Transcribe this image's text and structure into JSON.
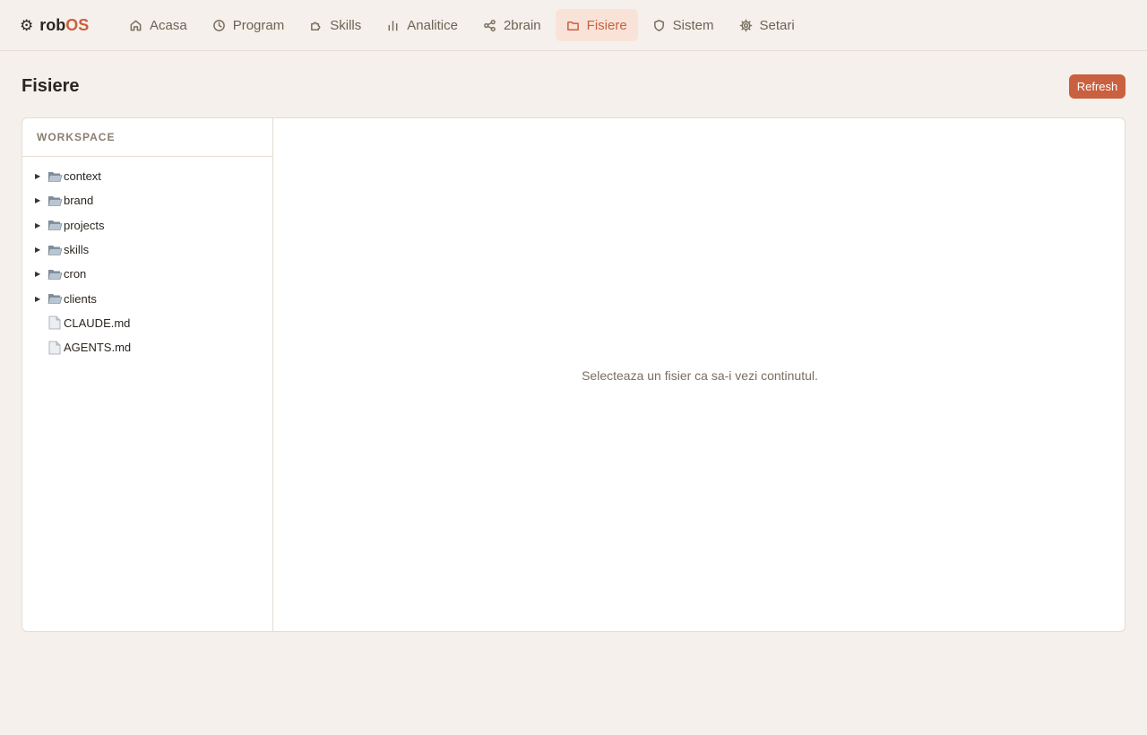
{
  "brand": {
    "prefix": "rob",
    "accent": "OS",
    "icon": "gear-icon"
  },
  "nav": [
    {
      "label": "Acasa",
      "icon": "home-icon",
      "active": false
    },
    {
      "label": "Program",
      "icon": "clock-icon",
      "active": false
    },
    {
      "label": "Skills",
      "icon": "puzzle-icon",
      "active": false
    },
    {
      "label": "Analitice",
      "icon": "bar-chart-icon",
      "active": false
    },
    {
      "label": "2brain",
      "icon": "share-icon",
      "active": false
    },
    {
      "label": "Fisiere",
      "icon": "folder-icon",
      "active": true
    },
    {
      "label": "Sistem",
      "icon": "shield-icon",
      "active": false
    },
    {
      "label": "Setari",
      "icon": "settings-icon",
      "active": false
    }
  ],
  "page": {
    "title": "Fisiere",
    "refresh_label": "Refresh"
  },
  "sidebar": {
    "header": "WORKSPACE",
    "items": [
      {
        "name": "context",
        "type": "folder"
      },
      {
        "name": "brand",
        "type": "folder"
      },
      {
        "name": "projects",
        "type": "folder"
      },
      {
        "name": "skills",
        "type": "folder"
      },
      {
        "name": "cron",
        "type": "folder"
      },
      {
        "name": "clients",
        "type": "folder"
      },
      {
        "name": "CLAUDE.md",
        "type": "file"
      },
      {
        "name": "AGENTS.md",
        "type": "file"
      }
    ]
  },
  "content": {
    "empty_message": "Selecteaza un fisier ca sa-i vezi continutul."
  },
  "colors": {
    "accent": "#c9603f",
    "background": "#f5f0eb",
    "active_nav_bg": "#f9e3d9"
  }
}
